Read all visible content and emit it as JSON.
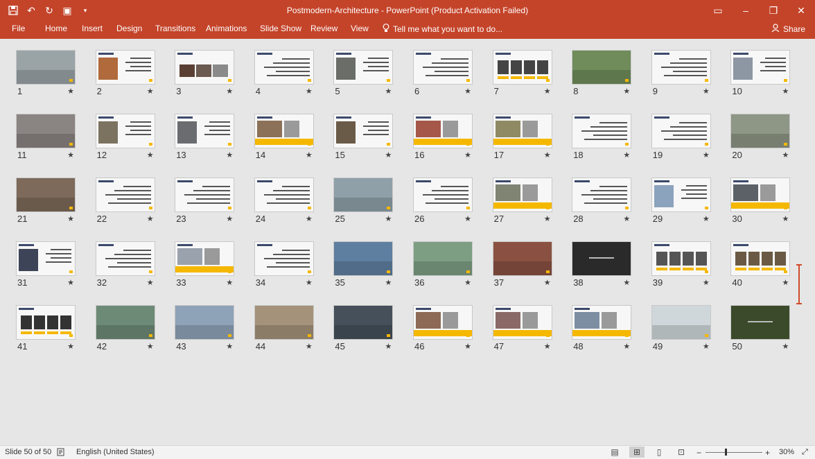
{
  "window": {
    "title": "Postmodern-Architecture - PowerPoint (Product Activation Failed)",
    "qat_icons": [
      "save-icon",
      "undo-icon",
      "redo-icon",
      "present-icon",
      "customize-icon"
    ],
    "controls": [
      "ribbon-display-icon",
      "minimize-icon",
      "restore-icon",
      "close-icon"
    ]
  },
  "ribbon": {
    "tabs": [
      "File",
      "Home",
      "Insert",
      "Design",
      "Transitions",
      "Animations",
      "Slide Show",
      "Review",
      "View"
    ],
    "tell_me": "Tell me what you want to do...",
    "share": "Share"
  },
  "slides": [
    {
      "n": "1",
      "kind": "photo",
      "c": "#9aa3a6"
    },
    {
      "n": "2",
      "kind": "pic-left",
      "c": "#b06a3c"
    },
    {
      "n": "3",
      "kind": "pic-row",
      "c": "#5a4034"
    },
    {
      "n": "4",
      "kind": "text"
    },
    {
      "n": "5",
      "kind": "pic-left",
      "c": "#6b6e68"
    },
    {
      "n": "6",
      "kind": "text"
    },
    {
      "n": "7",
      "kind": "portraits",
      "c": "#444"
    },
    {
      "n": "8",
      "kind": "photo",
      "c": "#6f8c5a"
    },
    {
      "n": "9",
      "kind": "text"
    },
    {
      "n": "10",
      "kind": "pic-left",
      "c": "#8d96a3"
    },
    {
      "n": "11",
      "kind": "photo",
      "c": "#8a8482"
    },
    {
      "n": "12",
      "kind": "pic-left",
      "c": "#7b7360"
    },
    {
      "n": "13",
      "kind": "pic-left",
      "c": "#6a6c70"
    },
    {
      "n": "14",
      "kind": "pic-band",
      "c": "#8b7157"
    },
    {
      "n": "15",
      "kind": "pic-left",
      "c": "#6a5a48"
    },
    {
      "n": "16",
      "kind": "pic-band",
      "c": "#a5574a"
    },
    {
      "n": "17",
      "kind": "pic-band",
      "c": "#8f8a63"
    },
    {
      "n": "18",
      "kind": "text"
    },
    {
      "n": "19",
      "kind": "text"
    },
    {
      "n": "20",
      "kind": "photo",
      "c": "#8e9685"
    },
    {
      "n": "21",
      "kind": "photo",
      "c": "#7d6a5a"
    },
    {
      "n": "22",
      "kind": "text"
    },
    {
      "n": "23",
      "kind": "text"
    },
    {
      "n": "24",
      "kind": "text"
    },
    {
      "n": "25",
      "kind": "photo",
      "c": "#8fa0a8"
    },
    {
      "n": "26",
      "kind": "text"
    },
    {
      "n": "27",
      "kind": "pic-band",
      "c": "#7f8473"
    },
    {
      "n": "28",
      "kind": "text"
    },
    {
      "n": "29",
      "kind": "pic-left",
      "c": "#8ca3bd"
    },
    {
      "n": "30",
      "kind": "pic-band",
      "c": "#5b6167"
    },
    {
      "n": "31",
      "kind": "pic-left",
      "c": "#3e4458"
    },
    {
      "n": "32",
      "kind": "text"
    },
    {
      "n": "33",
      "kind": "pic-band",
      "c": "#9aa2ad"
    },
    {
      "n": "34",
      "kind": "text"
    },
    {
      "n": "35",
      "kind": "photo",
      "c": "#5e7fa0"
    },
    {
      "n": "36",
      "kind": "photo",
      "c": "#7e9e84"
    },
    {
      "n": "37",
      "kind": "photo",
      "c": "#8a5142"
    },
    {
      "n": "38",
      "kind": "dark",
      "c": "#2a2a2a"
    },
    {
      "n": "39",
      "kind": "portraits",
      "c": "#555"
    },
    {
      "n": "40",
      "kind": "portraits",
      "c": "#6a5a45"
    },
    {
      "n": "41",
      "kind": "portraits",
      "c": "#333"
    },
    {
      "n": "42",
      "kind": "photo",
      "c": "#6d8a76"
    },
    {
      "n": "43",
      "kind": "photo",
      "c": "#8ea3b8"
    },
    {
      "n": "44",
      "kind": "photo",
      "c": "#a4927a"
    },
    {
      "n": "45",
      "kind": "photo",
      "c": "#45505a"
    },
    {
      "n": "46",
      "kind": "pic-band",
      "c": "#8c6a55"
    },
    {
      "n": "47",
      "kind": "pic-band",
      "c": "#8a6a66"
    },
    {
      "n": "48",
      "kind": "pic-band",
      "c": "#7d8ea2"
    },
    {
      "n": "49",
      "kind": "photo",
      "c": "#cfd7da"
    },
    {
      "n": "50",
      "kind": "dark",
      "c": "#3a4a2a"
    }
  ],
  "status": {
    "slide_indicator": "Slide 50 of 50",
    "language": "English (United States)",
    "zoom": "30%"
  },
  "colors": {
    "accent": "#c4442a",
    "highlight": "#f5b800",
    "selection": "#d04a2a"
  }
}
